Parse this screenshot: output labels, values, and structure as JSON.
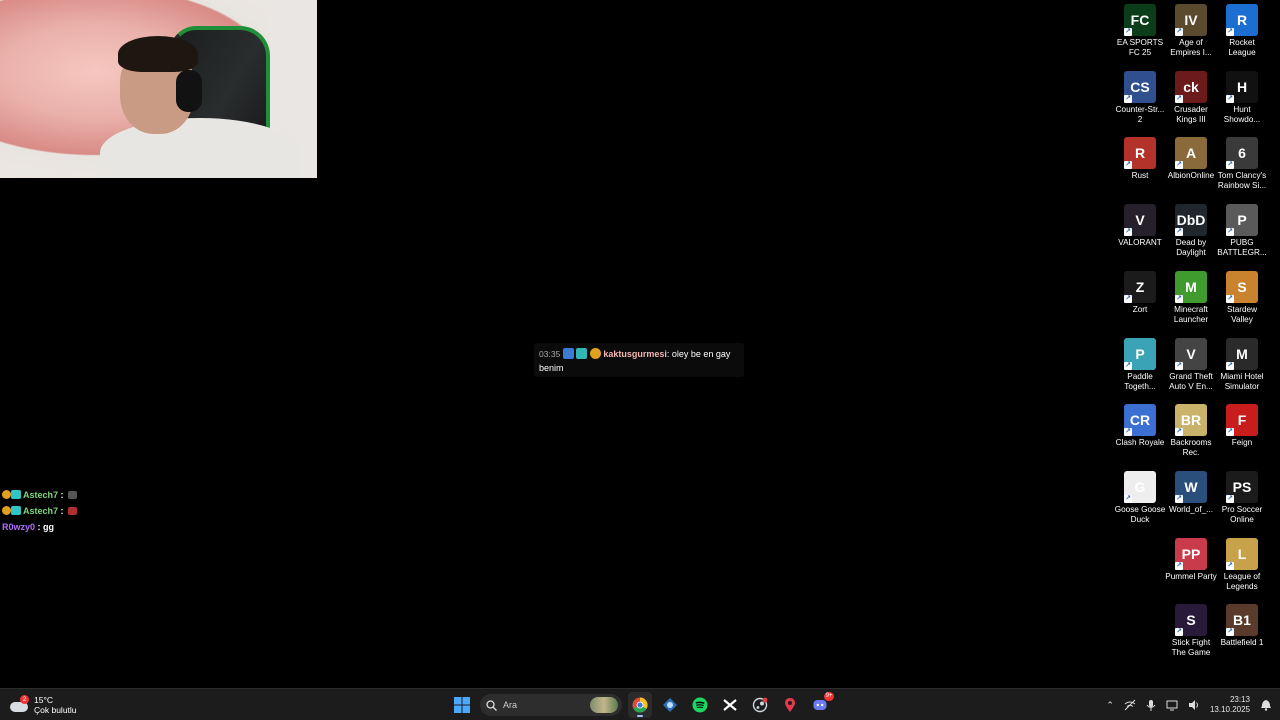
{
  "desktop": {
    "icons": [
      {
        "label": "EA SPORTS FC 25",
        "icon": "ea-fc25-icon",
        "color": "#0b3d1a",
        "glyph": "FC"
      },
      {
        "label": "Age of Empires I...",
        "icon": "age-of-empires-icon",
        "color": "#5b4a2e",
        "glyph": "IV"
      },
      {
        "label": "Rocket League",
        "icon": "rocket-league-icon",
        "color": "#1c6fd1",
        "glyph": "R"
      },
      {
        "label": "Counter-Str... 2",
        "icon": "counter-strike-icon",
        "color": "#2f4f8f",
        "glyph": "CS"
      },
      {
        "label": "Crusader Kings III",
        "icon": "crusader-kings-icon",
        "color": "#6d1a1a",
        "glyph": "ck"
      },
      {
        "label": "Hunt Showdo...",
        "icon": "hunt-showdown-icon",
        "color": "#111111",
        "glyph": "H"
      },
      {
        "label": "Rust",
        "icon": "rust-icon",
        "color": "#b3322a",
        "glyph": "R"
      },
      {
        "label": "AlbionOnline",
        "icon": "albion-online-icon",
        "color": "#8a6a3b",
        "glyph": "A"
      },
      {
        "label": "Tom Clancy's Rainbow Si...",
        "icon": "rainbow-six-icon",
        "color": "#3a3a3a",
        "glyph": "6"
      },
      {
        "label": "VALORANT",
        "icon": "valorant-icon",
        "color": "#26202a",
        "glyph": "V"
      },
      {
        "label": "Dead by Daylight",
        "icon": "dead-by-daylight-icon",
        "color": "#20262e",
        "glyph": "DbD"
      },
      {
        "label": "PUBG BATTLEGR...",
        "icon": "pubg-icon",
        "color": "#5a5a5a",
        "glyph": "P"
      },
      {
        "label": "Zort",
        "icon": "zort-icon",
        "color": "#1b1b1b",
        "glyph": "Z"
      },
      {
        "label": "Minecraft Launcher",
        "icon": "minecraft-icon",
        "color": "#3f9b2e",
        "glyph": "M"
      },
      {
        "label": "Stardew Valley",
        "icon": "stardew-valley-icon",
        "color": "#c9822d",
        "glyph": "S"
      },
      {
        "label": "Paddle Togeth...",
        "icon": "paddle-together-icon",
        "color": "#3aa3b5",
        "glyph": "P"
      },
      {
        "label": "Grand Theft Auto V En...",
        "icon": "gta5-icon",
        "color": "#444444",
        "glyph": "V"
      },
      {
        "label": "Miami Hotel Simulator",
        "icon": "miami-hotel-icon",
        "color": "#2a2a2a",
        "glyph": "M"
      },
      {
        "label": "Clash Royale",
        "icon": "clash-royale-icon",
        "color": "#3b6fd1",
        "glyph": "CR"
      },
      {
        "label": "Backrooms Rec.",
        "icon": "backrooms-rec-icon",
        "color": "#c9b36a",
        "glyph": "BR"
      },
      {
        "label": "Feign",
        "icon": "feign-icon",
        "color": "#c81d1d",
        "glyph": "F"
      },
      {
        "label": "Goose Goose Duck",
        "icon": "goose-goose-duck-icon",
        "color": "#eeeeee",
        "glyph": "G"
      },
      {
        "label": "World_of_...",
        "icon": "world-of-warships-icon",
        "color": "#2a4f7a",
        "glyph": "W"
      },
      {
        "label": "Pro Soccer Online",
        "icon": "pro-soccer-online-icon",
        "color": "#1b1b1b",
        "glyph": "PS"
      },
      {
        "label": "Pummel Party",
        "icon": "pummel-party-icon",
        "color": "#c93a4b",
        "glyph": "PP"
      },
      {
        "label": "League of Legends",
        "icon": "league-of-legends-icon",
        "color": "#c8a24a",
        "glyph": "L"
      },
      {
        "label": "Stick Fight The Game",
        "icon": "stick-fight-icon",
        "color": "#2a1a3a",
        "glyph": "S"
      },
      {
        "label": "Battlefield 1",
        "icon": "battlefield-1-icon",
        "color": "#5a3a2a",
        "glyph": "B1"
      }
    ]
  },
  "chat_popup": {
    "time": "03:35",
    "username": "kaktusgurmesi",
    "message": ": oley be en gay benim",
    "badge_colors": [
      "#3b7bd6",
      "#33b5b5",
      "#e0a020"
    ]
  },
  "stream_chat": [
    {
      "username": "Astech7",
      "message": " : ",
      "color": "#7dd87d",
      "badge": "1"
    },
    {
      "username": "Astech7",
      "message": " : ",
      "color": "#7dd87d",
      "badge": "1"
    },
    {
      "username": "R0wzy0",
      "message": " : gg",
      "color": "#b26bff",
      "badge": ""
    }
  ],
  "taskbar": {
    "weather": {
      "temp": "15°C",
      "desc": "Çok bulutlu",
      "notif": "2"
    },
    "search_placeholder": "Ara",
    "apps": [
      {
        "name": "start-button",
        "icon": "windows-icon"
      },
      {
        "name": "chrome-button",
        "icon": "chrome-icon"
      },
      {
        "name": "network-app-button",
        "icon": "network-app-icon"
      },
      {
        "name": "spotify-button",
        "icon": "spotify-icon"
      },
      {
        "name": "capcut-button",
        "icon": "capcut-icon"
      },
      {
        "name": "steam-button",
        "icon": "steam-icon"
      },
      {
        "name": "riot-button",
        "icon": "riot-icon"
      },
      {
        "name": "discord-button",
        "icon": "discord-icon"
      }
    ],
    "discord_badge": "9+",
    "clock": {
      "time": "23:13",
      "date": "13.10.2025"
    }
  },
  "colors": {
    "accent": "#9ec3ff",
    "taskbar": "#1c1c1c",
    "background": "#000000"
  }
}
